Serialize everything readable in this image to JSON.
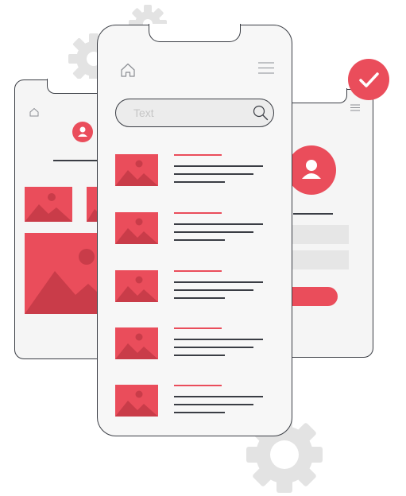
{
  "search": {
    "placeholder": "Text"
  },
  "colors": {
    "accent": "#ea4d5b",
    "outline": "#3a3d44",
    "gear": "#e3e3e3",
    "screen": "#f5f5f5"
  },
  "icons": [
    "home-icon",
    "menu-icon",
    "search-icon",
    "user-icon",
    "check-icon",
    "image-icon",
    "gear-icon"
  ],
  "list": {
    "items": 5
  }
}
